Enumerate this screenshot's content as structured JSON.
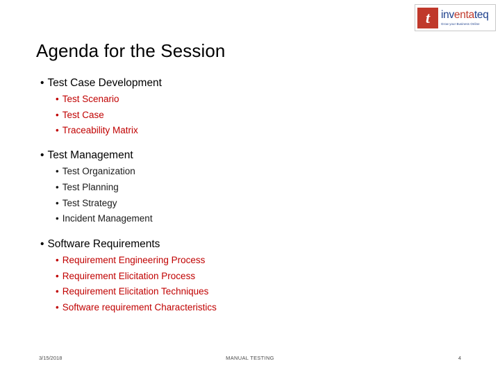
{
  "logo": {
    "mark_letter": "t",
    "name_part_a": "inv",
    "name_part_b": "enta",
    "name_part_c": "teq",
    "tagline": "Grow your Business Online"
  },
  "slide": {
    "title": "Agenda for the Session",
    "bullet_char": "•",
    "groups": [
      {
        "heading": "Test Case Development",
        "items": [
          {
            "label": "Test Scenario",
            "color": "red"
          },
          {
            "label": "Test Case",
            "color": "red"
          },
          {
            "label": "Traceability Matrix",
            "color": "red"
          }
        ]
      },
      {
        "heading": "Test Management",
        "items": [
          {
            "label": "Test Organization",
            "color": "black"
          },
          {
            "label": "Test Planning",
            "color": "black"
          },
          {
            "label": "Test Strategy",
            "color": "black"
          },
          {
            "label": "Incident Management",
            "color": "black"
          }
        ]
      },
      {
        "heading": "Software Requirements",
        "items": [
          {
            "label": "Requirement Engineering Process",
            "color": "red"
          },
          {
            "label": "Requirement Elicitation Process",
            "color": "red"
          },
          {
            "label": "Requirement Elicitation Techniques",
            "color": "red"
          },
          {
            "label": "Software requirement Characteristics",
            "color": "red"
          }
        ]
      }
    ]
  },
  "footer": {
    "date": "3/15/2018",
    "center": "MANUAL TESTING",
    "page_number": "4"
  }
}
